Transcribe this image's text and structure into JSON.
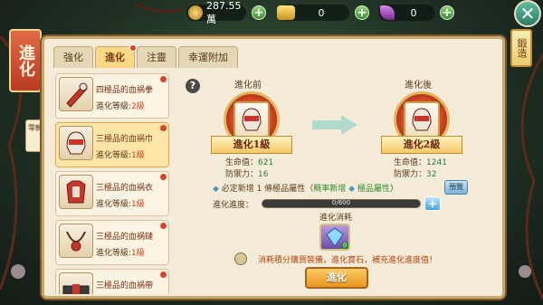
{
  "top_bar": {
    "coins": "287.55萬",
    "gold": "0",
    "feather": "0",
    "plus": "+",
    "close": "✕"
  },
  "left_banner": "進化",
  "right_banner": "鍛造",
  "side_tab": "零轉",
  "tabs": [
    {
      "label": "強化",
      "active": false
    },
    {
      "label": "進化",
      "active": true
    },
    {
      "label": "注靈",
      "active": false
    },
    {
      "label": "幸運附加",
      "active": false
    }
  ],
  "items": [
    {
      "name": "四極品的血祸拳",
      "lvl_label": "進化等級:",
      "lvl_value": "2級"
    },
    {
      "name": "三極品的血祸巾",
      "lvl_label": "進化等級:",
      "lvl_value": "1級"
    },
    {
      "name": "三極品的血祸衣",
      "lvl_label": "進化等級:",
      "lvl_value": "1級"
    },
    {
      "name": "三極品的血祸鏈",
      "lvl_label": "進化等級:",
      "lvl_value": "1級"
    },
    {
      "name": "三極品的血祸帶",
      "lvl_label": "",
      "lvl_value": ""
    }
  ],
  "help": "?",
  "before": {
    "title": "進化前",
    "ribbon": "進化1級",
    "hp_label": "生命值：",
    "hp": "621",
    "def_label": "防禦力：",
    "def": "16"
  },
  "after": {
    "title": "進化後",
    "ribbon": "進化2級",
    "hp_label": "生命值：",
    "hp": "1241",
    "def_label": "防禦力：",
    "def": "32"
  },
  "attr_text_1": "必定新增 1 條極品屬性（",
  "attr_green_1": "概率新增",
  "attr_green_2": "極品屬性",
  "attr_text_2": "）",
  "preview": "預覽",
  "progress_label": "進化進度：",
  "progress_text": "0/600",
  "progress_fraction": 0,
  "consume_title": "進化消耗",
  "gem_badge": "0",
  "notice": "消耗積分購買裝備，進化寶石，補充進化進度值！",
  "action": "進化"
}
